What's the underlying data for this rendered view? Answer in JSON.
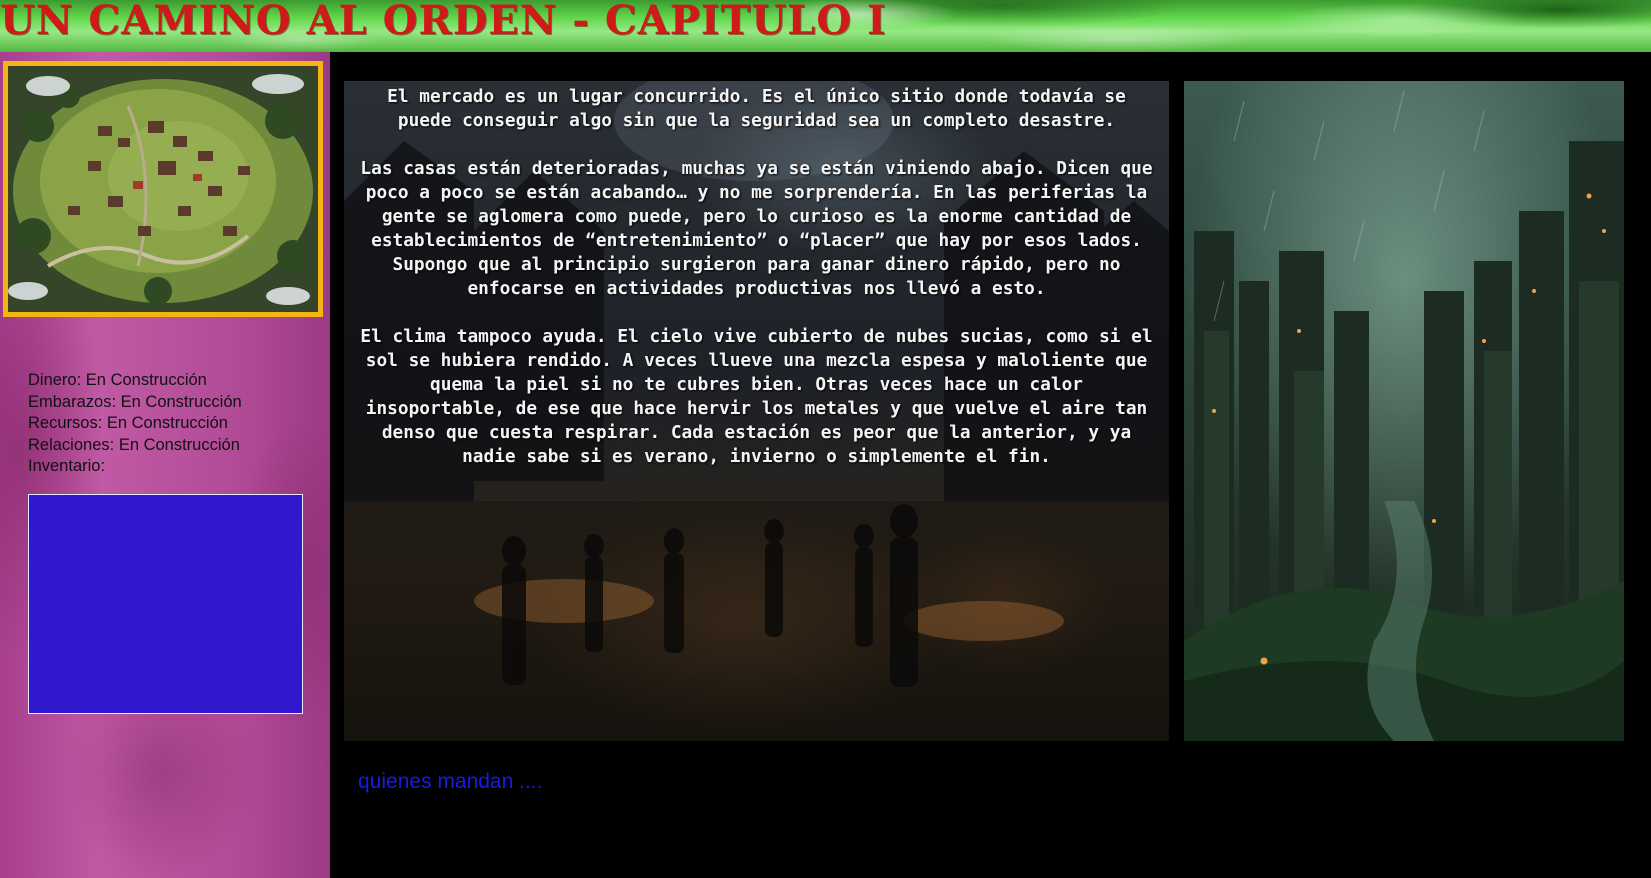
{
  "header": {
    "title": "UN CAMINO AL ORDEN - CAPITULO I"
  },
  "sidebar": {
    "map_image": "fantasy-town-map-thumbnail",
    "stats": [
      {
        "label": "Dinero:",
        "value": "En Construcción"
      },
      {
        "label": "Embarazos:",
        "value": "En Construcción"
      },
      {
        "label": "Recursos:",
        "value": "En Construcción"
      },
      {
        "label": "Relaciones:",
        "value": "En Construcción"
      }
    ],
    "inventory_label": "Inventario:"
  },
  "story": {
    "paragraphs": [
      "El mercado es un lugar concurrido. Es el único sitio donde todavía se puede conseguir algo sin que la seguridad sea un completo desastre.",
      "Las casas están deterioradas, muchas ya se están viniendo abajo. Dicen que poco a poco se están acabando… y no me sorprendería. En las periferias la gente se aglomera como puede, pero lo curioso es la enorme cantidad de establecimientos de “entretenimiento” o “placer” que hay por esos lados. Supongo que al principio surgieron para ganar dinero rápido, pero no enfocarse en actividades productivas nos llevó a esto.",
      "El clima tampoco ayuda. El cielo vive cubierto de nubes sucias, como si el sol se hubiera rendido. A veces llueve una mezcla espesa y maloliente que quema la piel si no te cubres bien. Otras veces hace un calor insoportable, de ese que hace hervir los metales y que vuelve el aire tan denso que cuesta respirar. Cada estación es peor que la anterior, y ya nadie sabe si es verano, invierno o simplemente el fin."
    ],
    "background_image": "dark-market-street-crowd"
  },
  "side_image": "rainy-ruined-city-overgrown",
  "navigation": {
    "continue_link": "quienes mandan ...."
  },
  "colors": {
    "title": "#cf1a1a",
    "sidebar": "#b24c98",
    "map_border": "#f5b412",
    "inventory": "#3118cf",
    "link": "#1a1ae6"
  }
}
